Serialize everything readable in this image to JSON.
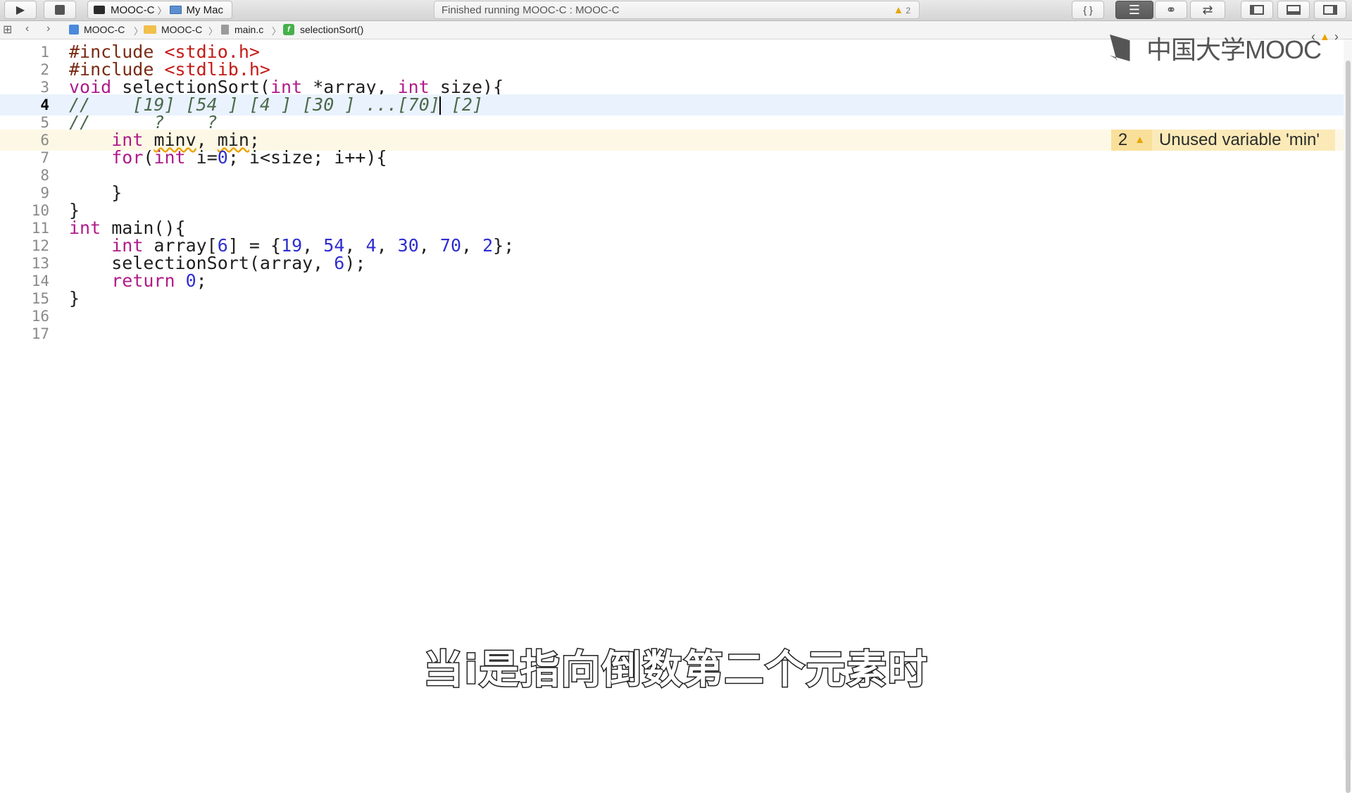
{
  "toolbar": {
    "scheme": "MOOC-C",
    "destination": "My Mac",
    "activity_status": "Finished running MOOC-C : MOOC-C",
    "warning_count": "2"
  },
  "jumpbar": {
    "crumbs": [
      "MOOC-C",
      "MOOC-C",
      "main.c",
      "selectionSort()"
    ]
  },
  "editor": {
    "current_line": 4,
    "lines": [
      {
        "n": "1",
        "segments": [
          {
            "t": "#include ",
            "c": "pp"
          },
          {
            "t": "<stdio.h>",
            "c": "str"
          }
        ]
      },
      {
        "n": "2",
        "segments": [
          {
            "t": "#include ",
            "c": "pp"
          },
          {
            "t": "<stdlib.h>",
            "c": "str"
          }
        ]
      },
      {
        "n": "3",
        "segments": [
          {
            "t": "void",
            "c": "kw"
          },
          {
            "t": " selectionSort(",
            "c": ""
          },
          {
            "t": "int",
            "c": "kw"
          },
          {
            "t": " *array, ",
            "c": ""
          },
          {
            "t": "int",
            "c": "kw"
          },
          {
            "t": " size){",
            "c": ""
          }
        ]
      },
      {
        "n": "4",
        "segments": [
          {
            "t": "//    [19] [54 ] [4 ] [30 ] ...[70]",
            "c": "cm"
          },
          {
            "t": "",
            "c": "cursor"
          },
          {
            "t": " [2]",
            "c": "cm"
          }
        ]
      },
      {
        "n": "5",
        "segments": [
          {
            "t": "//      ?    ?",
            "c": "cm"
          }
        ]
      },
      {
        "n": "6",
        "segments": [
          {
            "t": "    ",
            "c": ""
          },
          {
            "t": "int",
            "c": "kw"
          },
          {
            "t": " ",
            "c": ""
          },
          {
            "t": "minv",
            "c": "squiggle"
          },
          {
            "t": ", ",
            "c": ""
          },
          {
            "t": "min",
            "c": "squiggle"
          },
          {
            "t": ";",
            "c": ""
          }
        ]
      },
      {
        "n": "7",
        "segments": [
          {
            "t": "    ",
            "c": ""
          },
          {
            "t": "for",
            "c": "kw"
          },
          {
            "t": "(",
            "c": ""
          },
          {
            "t": "int",
            "c": "kw"
          },
          {
            "t": " i=",
            "c": ""
          },
          {
            "t": "0",
            "c": "num"
          },
          {
            "t": "; i<size; i++){",
            "c": ""
          }
        ]
      },
      {
        "n": "8",
        "segments": [
          {
            "t": "",
            "c": ""
          }
        ]
      },
      {
        "n": "9",
        "segments": [
          {
            "t": "    }",
            "c": ""
          }
        ]
      },
      {
        "n": "10",
        "segments": [
          {
            "t": "}",
            "c": ""
          }
        ]
      },
      {
        "n": "11",
        "segments": [
          {
            "t": "int",
            "c": "kw"
          },
          {
            "t": " main(){",
            "c": ""
          }
        ]
      },
      {
        "n": "12",
        "segments": [
          {
            "t": "    ",
            "c": ""
          },
          {
            "t": "int",
            "c": "kw"
          },
          {
            "t": " array[",
            "c": ""
          },
          {
            "t": "6",
            "c": "num"
          },
          {
            "t": "] = {",
            "c": ""
          },
          {
            "t": "19",
            "c": "num"
          },
          {
            "t": ", ",
            "c": ""
          },
          {
            "t": "54",
            "c": "num"
          },
          {
            "t": ", ",
            "c": ""
          },
          {
            "t": "4",
            "c": "num"
          },
          {
            "t": ", ",
            "c": ""
          },
          {
            "t": "30",
            "c": "num"
          },
          {
            "t": ", ",
            "c": ""
          },
          {
            "t": "70",
            "c": "num"
          },
          {
            "t": ", ",
            "c": ""
          },
          {
            "t": "2",
            "c": "num"
          },
          {
            "t": "};",
            "c": ""
          }
        ]
      },
      {
        "n": "13",
        "segments": [
          {
            "t": "    selectionSort(array, ",
            "c": ""
          },
          {
            "t": "6",
            "c": "num"
          },
          {
            "t": ");",
            "c": ""
          }
        ]
      },
      {
        "n": "14",
        "segments": [
          {
            "t": "    ",
            "c": ""
          },
          {
            "t": "return",
            "c": "kw"
          },
          {
            "t": " ",
            "c": ""
          },
          {
            "t": "0",
            "c": "num"
          },
          {
            "t": ";",
            "c": ""
          }
        ]
      },
      {
        "n": "15",
        "segments": [
          {
            "t": "}",
            "c": ""
          }
        ]
      },
      {
        "n": "16",
        "segments": [
          {
            "t": "",
            "c": ""
          }
        ]
      },
      {
        "n": "17",
        "segments": [
          {
            "t": "",
            "c": ""
          }
        ]
      }
    ],
    "issue": {
      "line": 6,
      "count": "2",
      "message": "Unused variable 'min'"
    }
  },
  "watermark": {
    "text": "中国大学MOOC"
  },
  "subtitle": "当i是指向倒数第二个元素时",
  "colors": {
    "keyword": "#b01b8a",
    "preprocessor": "#7a2b14",
    "string": "#c41a16",
    "number": "#2e2ed0",
    "comment": "#4b6a4b",
    "current_line_bg": "#eaf2fe",
    "warning_line_bg": "#fdf8e6",
    "warning_accent": "#e9a400"
  },
  "icons": [
    "run-icon",
    "stop-icon",
    "terminal-icon",
    "mac-icon",
    "warning-icon",
    "standard-editor-icon",
    "assistant-editor-icon",
    "version-editor-icon",
    "navigator-toggle-icon",
    "debug-area-toggle-icon",
    "utilities-toggle-icon",
    "related-items-icon",
    "back-icon",
    "forward-icon",
    "project-icon",
    "folder-icon",
    "c-file-icon",
    "function-icon",
    "mooc-logo-icon"
  ]
}
